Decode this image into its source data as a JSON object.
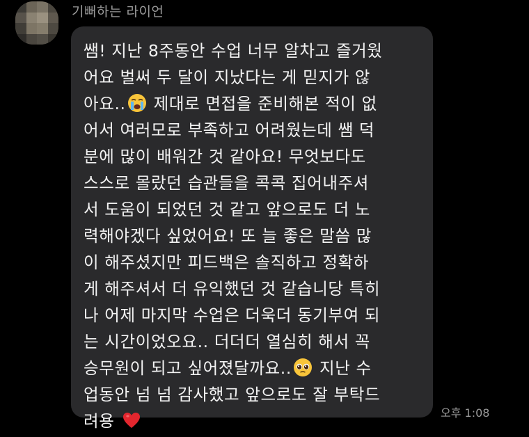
{
  "chat": {
    "sender_name": "기뻐하는 라이언",
    "timestamp": "오후 1:08",
    "message": {
      "lines": [
        {
          "before": "쌤! 지난 8주동안 수업 너무 알차고 즐거웠",
          "after": ""
        },
        {
          "before": "어요 벌써 두 달이 지났다는 게 믿지가 않",
          "after": ""
        },
        {
          "before": "아요..",
          "after": " 제대로 면접을 준비해본 적이 없"
        },
        {
          "before": "어서 여러모로 부족하고 어려웠는데 쌤 덕",
          "after": ""
        },
        {
          "before": "분에 많이 배워간 것 같아요! 무엇보다도",
          "after": ""
        },
        {
          "before": "스스로 몰랐던 습관들을 콕콕 집어내주셔",
          "after": ""
        },
        {
          "before": "서 도움이 되었던 것 같고 앞으로도 더 노",
          "after": ""
        },
        {
          "before": "력해야겠다 싶었어요! 또 늘 좋은 말씀 많",
          "after": ""
        },
        {
          "before": "이 해주셨지만 피드백은 솔직하고 정확하",
          "after": ""
        },
        {
          "before": "게 해주셔서 더 유익했던 것 같습니당 특히",
          "after": ""
        },
        {
          "before": "나 어제 마지막 수업은 더욱더 동기부여 되",
          "after": ""
        },
        {
          "before": "는 시간이었오요.. 더더더 열심히 해서 꼭",
          "after": ""
        },
        {
          "before": "승무원이 되고 싶어졌달까요..",
          "after": " 지난 수"
        },
        {
          "before": "업동안 넘 넘 감사했고 앞으로도 잘 부탁드",
          "after": ""
        },
        {
          "before": "려용 ",
          "after": ""
        }
      ],
      "emojis": [
        {
          "line": 2,
          "name": "crying-face-icon"
        },
        {
          "line": 12,
          "name": "pleading-face-icon"
        },
        {
          "line": 14,
          "name": "red-heart-icon"
        }
      ]
    }
  },
  "colors": {
    "background": "#000000",
    "bubble": "#2a2a2c",
    "message_text": "#f2f2f2",
    "meta_text": "#9a9a9a"
  }
}
